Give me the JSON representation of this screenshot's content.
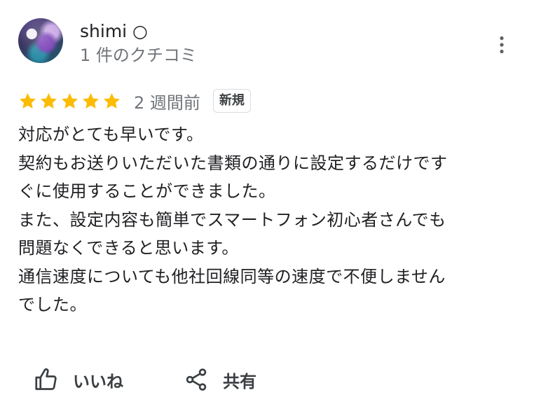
{
  "reviewer": {
    "name": "shimi ○",
    "review_count": "1 件のクチコミ"
  },
  "rating": {
    "stars": 5,
    "max_stars": 5,
    "time_ago": "2 週間前",
    "badge": "新規"
  },
  "review_lines": [
    "対応がとても早いです。",
    "契約もお送りいただいた書類の通りに設定するだけです",
    "ぐに使用することができました。",
    "また、設定内容も簡単でスマートフォン初心者さんでも",
    "問題なくできると思います。",
    "通信速度についても他社回線同等の速度で不便しません",
    "でした。"
  ],
  "actions": {
    "like_label": "いいね",
    "share_label": "共有"
  },
  "icons": {
    "more": "more-vert-icon",
    "star": "star-icon",
    "like": "thumb-up-icon",
    "share": "share-icon"
  },
  "colors": {
    "star": "#fbbc04",
    "muted_text": "#70757a",
    "primary_text": "#202124"
  }
}
